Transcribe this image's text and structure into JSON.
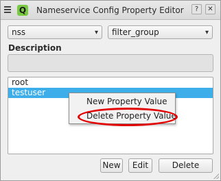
{
  "window": {
    "title": "Nameservice Config Property Editor",
    "app_icon_glyph": "Q",
    "help_label": "?",
    "close_label": "✕"
  },
  "selectors": {
    "service": {
      "value": "nss",
      "caret": "▾"
    },
    "group": {
      "value": "filter_group",
      "caret": "▾"
    }
  },
  "description": {
    "label": "Description",
    "value": ""
  },
  "list": {
    "items": [
      {
        "label": "root",
        "selected": false
      },
      {
        "label": "testuser",
        "selected": true
      }
    ]
  },
  "context_menu": {
    "items": [
      {
        "label": "New Property Value"
      },
      {
        "label": "Delete Property Value",
        "highlighted": true
      }
    ]
  },
  "buttons": {
    "new": "New",
    "edit": "Edit",
    "delete": "Delete"
  },
  "colors": {
    "selection": "#3daee9",
    "highlight_ring": "#e30000",
    "app_icon": "#7ac943"
  }
}
